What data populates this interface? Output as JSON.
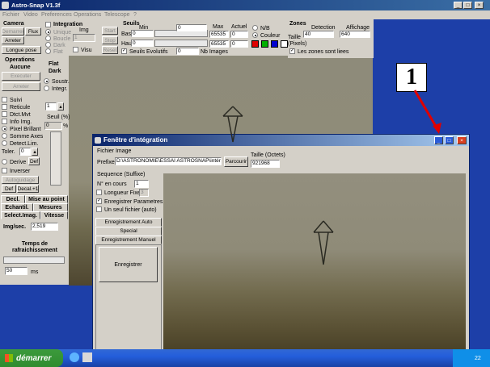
{
  "app": {
    "title": "Astro-Snap V1.3f",
    "menu": [
      "Fichier",
      "Video",
      "Preferences",
      "Operations",
      "Telescope",
      "?"
    ]
  },
  "camera": {
    "title": "Camera",
    "demarrer": "Demarrer",
    "flux": "Flux",
    "arreter": "Arreter",
    "longue_pose": "Longue pose"
  },
  "integration": {
    "title": "Integration",
    "unique": "Unique",
    "boucle": "Boucle",
    "dark": "Dark",
    "flat": "Flat",
    "img_label": "Img",
    "img_value": "1",
    "start": "Start",
    "stop": "Stop",
    "reset": "Reset",
    "visu": "Visu"
  },
  "seuils": {
    "title": "Seuils",
    "min": "Min",
    "max": "Max",
    "actuel": "Actuel",
    "bas": "Bas",
    "haut": "Haut",
    "bas_value": "0",
    "haut_value": "0",
    "min_value": "0",
    "max_bas": "65535",
    "max_haut": "65535",
    "actuel_bas": "0",
    "actuel_haut": "0",
    "evolutifs": "Seuils Evolutifs",
    "nb_images": "Nb Images",
    "nb_value": "0",
    "nb_label": "N/B",
    "couleur": "Couleur"
  },
  "zones": {
    "title": "Zones",
    "detection": "Detection",
    "affichage": "Affichage",
    "taille": "Taille",
    "pixels": "(Pixels)",
    "detection_value": "40",
    "affichage_value": "640",
    "liees": "Les zones sont liees"
  },
  "operations": {
    "title": "Operations",
    "state": "Aucune",
    "executer": "Executer",
    "arreter": "Arreter",
    "flat_dark": [
      "Flat",
      "Dark"
    ],
    "soustr": "Soustr.",
    "integr": "Integr.",
    "suivi": "Suivi",
    "reticule": "Reticule",
    "dtct_mvt": "Dtct.Mvt",
    "info_img": "Info Img.",
    "pixel_brillant": "Pixel Brillant",
    "somme_axes": "Somme Axes",
    "detect_lim": "Detect.Lim.",
    "seuil_label": "Seuil (%)",
    "seuil_value": "0",
    "seuil_pct": "%",
    "spin_value": "1",
    "toler": "Toler.",
    "toler_value": "0",
    "derive": "Derive",
    "def": "Def",
    "inverser": "Inverser",
    "autoguidage": "Autoguidage",
    "def2": "Def",
    "decal": "Decal.+1"
  },
  "tabs": {
    "decl": "Decl.",
    "mise_au_point": "Mise au point",
    "echantil": "Echantil.",
    "mesures": "Mesures",
    "select_imag": "Select.Imag.",
    "vitesse": "Vitesse"
  },
  "stats": {
    "img_sec_label": "Img/sec.",
    "img_sec_value": "2,519",
    "refresh_title": "Temps de rafraichissement",
    "refresh_value": "50",
    "refresh_unit": "ms"
  },
  "dialog": {
    "title": "Fenêtre d'intégration",
    "fichier_image": "Fichier Image",
    "prefixe_label": "Prefixe",
    "prefixe_value": "D:\\ASTRONOMIE\\ESSAI ASTROSNAP\\intér",
    "parcourir": "Parcourir",
    "taille_label": "Taille (Octets)",
    "taille_value": "921968",
    "sequence_title": "Sequence (Suffixe)",
    "n_en_cours": "N° en cours",
    "n_value": "1",
    "longueur_fixe": "Longueur Fixe",
    "longueur_value": "3",
    "enregistrer_params": "Enregistrer Parametres",
    "seul_fichier": "Un seul fichier (auto)",
    "enreg_auto": "Enregistrement Auto",
    "special": "Special",
    "enreg_manuel": "Enregistrement Manuel",
    "enregistrer": "Enregistrer"
  },
  "annotation": {
    "number": "1"
  },
  "taskbar": {
    "start": "démarrer",
    "clock": "22"
  }
}
